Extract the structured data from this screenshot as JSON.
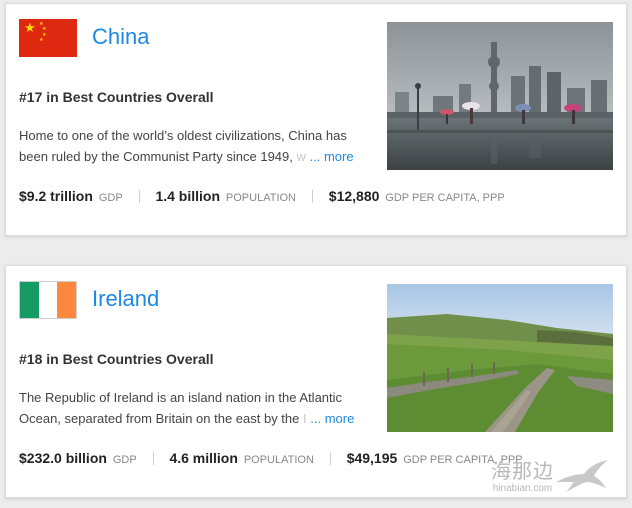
{
  "cards": [
    {
      "name": "China",
      "rank": "#17 in Best Countries Overall",
      "description_line1": "Home to one of the world’s oldest civilizations, China has",
      "description_line2": "been ruled by the Communist Party since 1949,",
      "description_fade": " w",
      "more": "... more",
      "stats": [
        {
          "value": "$9.2 trillion",
          "label": "GDP"
        },
        {
          "value": "1.4 billion",
          "label": "POPULATION"
        },
        {
          "value": "$12,880",
          "label": "GDP PER CAPITA, PPP"
        }
      ]
    },
    {
      "name": "Ireland",
      "rank": "#18 in Best Countries Overall",
      "description_line1": "The Republic of Ireland is an island nation in the Atlantic",
      "description_line2": "Ocean, separated from Britain on the east by the",
      "description_fade": " I",
      "more": "... more",
      "stats": [
        {
          "value": "$232.0 billion",
          "label": "GDP"
        },
        {
          "value": "4.6 million",
          "label": "POPULATION"
        },
        {
          "value": "$49,195",
          "label": "GDP PER CAPITA, PPP"
        }
      ]
    }
  ],
  "watermark": {
    "cn": "海那边",
    "en": "hinabian.com"
  },
  "colors": {
    "link": "#1e88e5",
    "flag_red": "#de2910",
    "flag_star": "#ffde00",
    "ie_green": "#169b62",
    "ie_white": "#ffffff",
    "ie_orange": "#ff883e"
  },
  "icons": [
    "china-flag-icon",
    "ireland-flag-icon",
    "swallow-logo-icon"
  ]
}
